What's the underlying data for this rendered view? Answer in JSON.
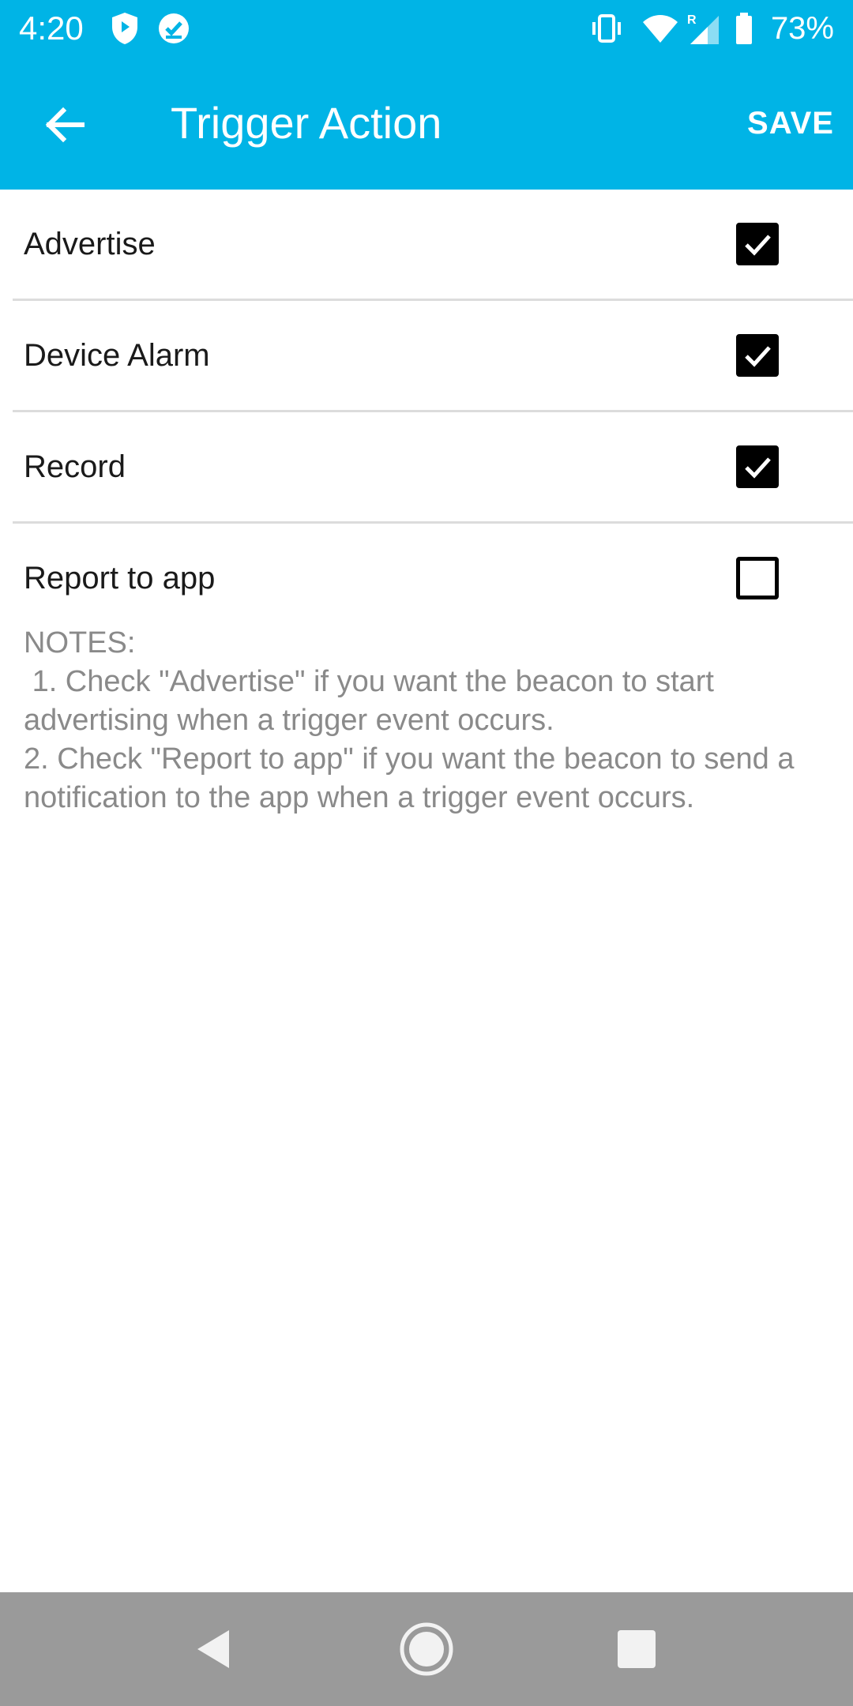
{
  "status_bar": {
    "time": "4:20",
    "battery_percent": "73%",
    "left_icons": [
      "shield-icon",
      "check-circle-icon"
    ],
    "right_icons": [
      "vibrate-icon",
      "wifi-icon",
      "signal-roaming-icon",
      "battery-icon"
    ]
  },
  "app_bar": {
    "title": "Trigger Action",
    "save_label": "SAVE",
    "back_icon": "arrow-back-icon",
    "background_color": "#00b4e6"
  },
  "options": [
    {
      "label": "Advertise",
      "checked": true
    },
    {
      "label": "Device Alarm",
      "checked": true
    },
    {
      "label": "Record",
      "checked": true
    },
    {
      "label": "Report to app",
      "checked": false
    }
  ],
  "notes": {
    "heading": "NOTES:",
    "line1": " 1. Check \"Advertise\" if you want the beacon to start advertising when a trigger event occurs.",
    "line2": "2. Check \"Report to app\" if you want the beacon to send a notification to the app when a trigger event occurs."
  },
  "nav_bar": {
    "buttons": [
      "back-triangle-icon",
      "home-circle-icon",
      "recents-square-icon"
    ]
  }
}
